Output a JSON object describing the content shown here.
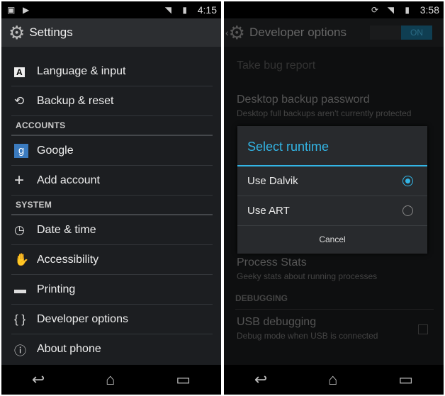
{
  "left": {
    "status": {
      "time": "4:15",
      "icons": [
        "image-icon",
        "play-store-icon",
        "wifi-icon",
        "signal-icon",
        "battery-icon"
      ]
    },
    "title": "Settings",
    "items": [
      {
        "label": "Language & input",
        "icon": "language-icon"
      },
      {
        "label": "Backup & reset",
        "icon": "backup-icon"
      }
    ],
    "accounts_header": "ACCOUNTS",
    "accounts": [
      {
        "label": "Google",
        "icon": "google-icon"
      },
      {
        "label": "Add account",
        "icon": "plus-icon"
      }
    ],
    "system_header": "SYSTEM",
    "system": [
      {
        "label": "Date & time",
        "icon": "clock-icon"
      },
      {
        "label": "Accessibility",
        "icon": "hand-icon"
      },
      {
        "label": "Printing",
        "icon": "printer-icon"
      },
      {
        "label": "Developer options",
        "icon": "braces-icon"
      },
      {
        "label": "About phone",
        "icon": "info-icon"
      }
    ]
  },
  "right": {
    "status": {
      "time": "3:58",
      "icons": [
        "rotate-icon",
        "wifi-icon",
        "signal-icon",
        "battery-icon"
      ]
    },
    "title": "Developer options",
    "toggle": "ON",
    "bug_report": "Take bug report",
    "backup_pw": {
      "title": "Desktop backup password",
      "sub": "Desktop full backups aren't currently protected"
    },
    "dialog": {
      "title": "Select runtime",
      "options": [
        {
          "label": "Use Dalvik",
          "selected": true
        },
        {
          "label": "Use ART",
          "selected": false
        }
      ],
      "cancel": "Cancel"
    },
    "process_stats": {
      "title": "Process Stats",
      "sub": "Geeky stats about running processes"
    },
    "debugging_header": "DEBUGGING",
    "usb": {
      "title": "USB debugging",
      "sub": "Debug mode when USB is connected",
      "checked": false
    }
  },
  "accent": "#33b5e5"
}
